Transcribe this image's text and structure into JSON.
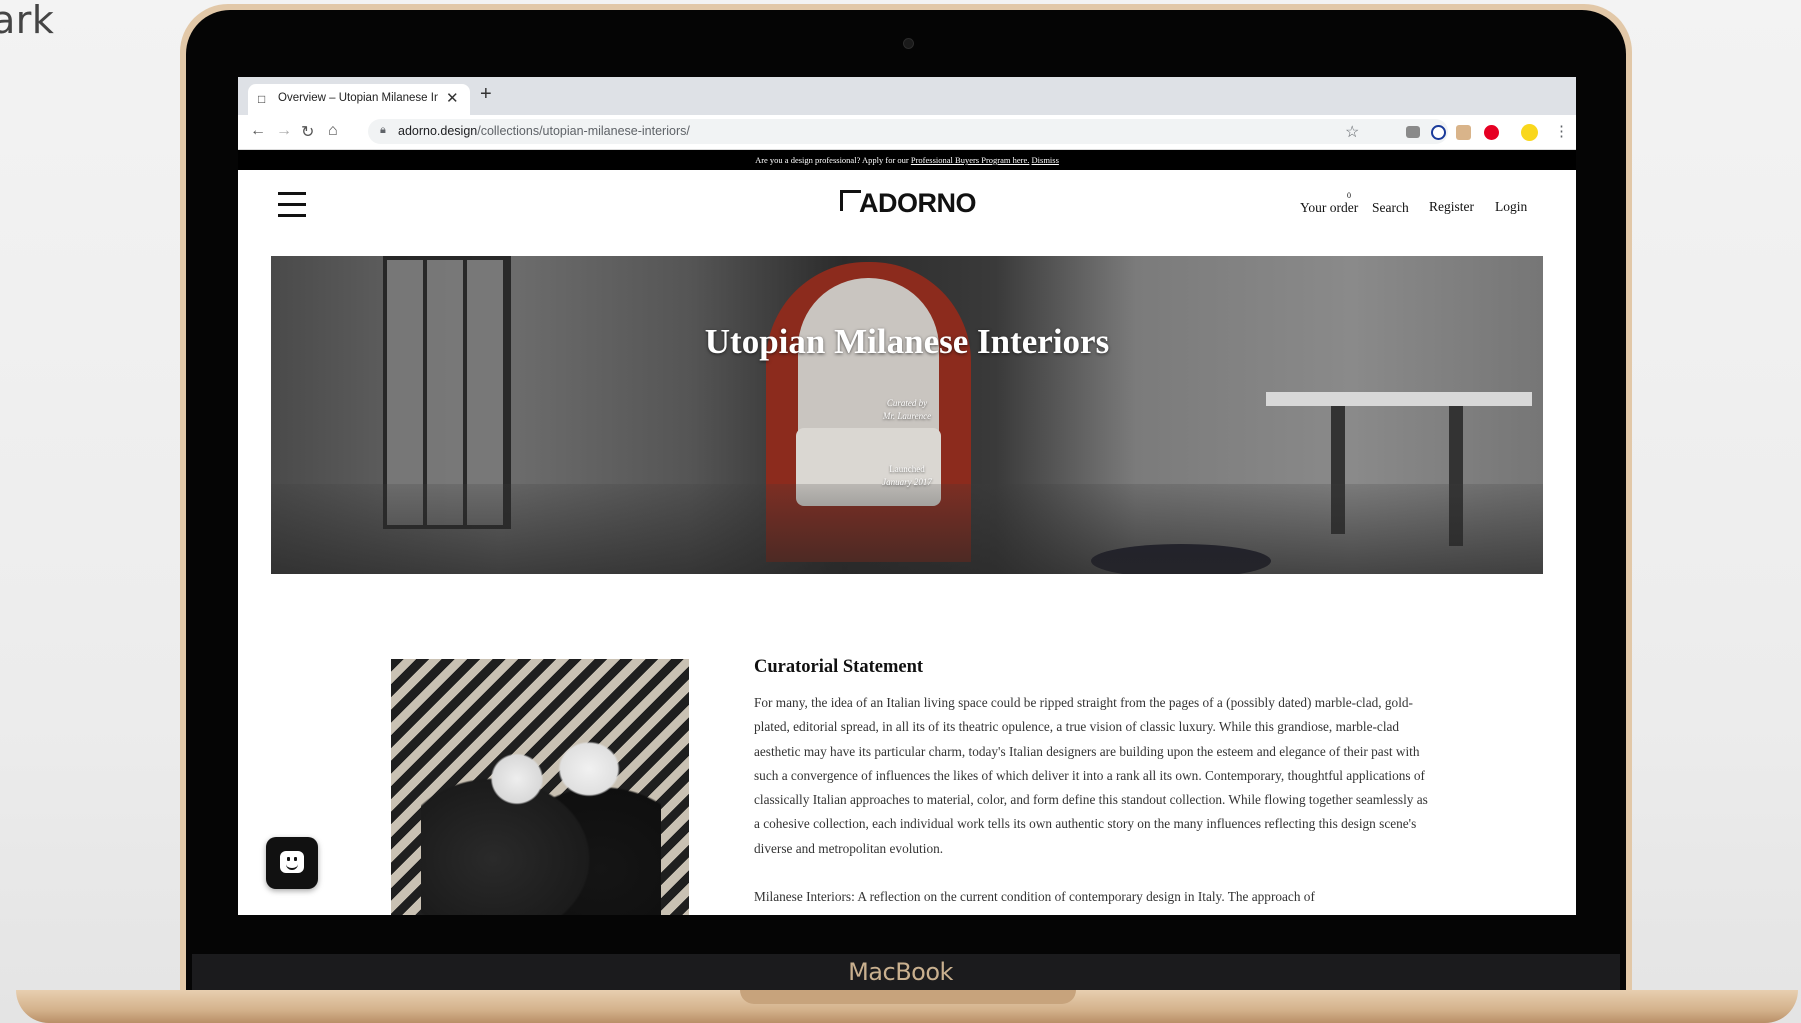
{
  "backdrop": {
    "partial_text": "ark"
  },
  "device": {
    "brand_label": "MacBook"
  },
  "browser": {
    "tab": {
      "title": "Overview – Utopian Milanese Interiors",
      "favicon": "adorno-favicon"
    },
    "new_tab_label": "+",
    "url_domain": "adorno.design",
    "url_path": "/collections/utopian-milanese-interiors/",
    "extensions": [
      "camera-icon",
      "block-icon",
      "extension-icon",
      "pinterest-icon",
      "note-icon"
    ],
    "colors": {
      "pinterest": "#e60023",
      "note": "#f9d71c",
      "block": "#1a3a9a"
    }
  },
  "site": {
    "promo": {
      "text": "Are you a design professional? Apply for our",
      "link_label": "Professional Buyers Program here.",
      "dismiss_label": "Dismiss"
    },
    "logo": "ADORNO",
    "nav": {
      "order_label": "Your order",
      "order_count": "0",
      "search_label": "Search",
      "register_label": "Register",
      "login_label": "Login"
    },
    "hero": {
      "title": "Utopian Milanese Interiors",
      "curated_label": "Curated by",
      "curator": "Mr. Laurence",
      "launched_label": "Launched",
      "launch_date": "January 2017"
    },
    "statement": {
      "heading": "Curatorial Statement",
      "body": "For many, the idea of an Italian living space could be ripped straight from the pages of a (possibly dated) marble-clad, gold-plated, editorial spread, in all its of its theatric opulence, a true vision of classic luxury. While this grandiose, marble-clad aesthetic may have its particular charm, today's Italian designers are building upon the esteem and elegance of their past with such a convergence of influences the likes of which deliver it into a rank all its own. Contemporary, thoughtful applications of classically Italian approaches to material, color, and form define this standout collection. While flowing together seamlessly as a cohesive collection, each individual work tells its own authentic story on the many influences reflecting this design scene's diverse and metropolitan evolution.",
      "body_continued": "Milanese Interiors: A reflection on the current condition of contemporary design in Italy. The approach of"
    }
  }
}
